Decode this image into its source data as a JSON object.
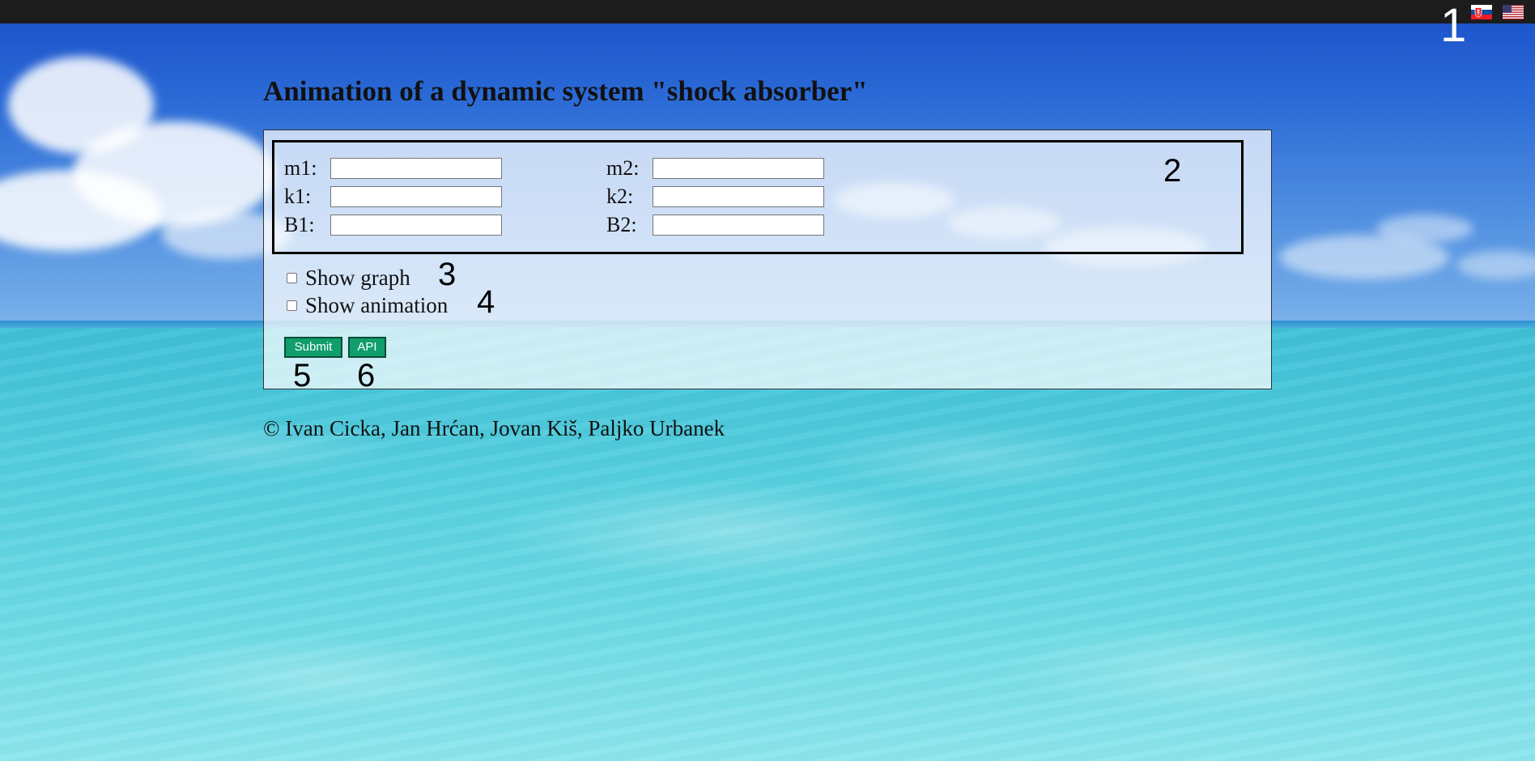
{
  "header": {
    "languages": [
      {
        "code": "sk",
        "icon": "slovak-flag-icon"
      },
      {
        "code": "en",
        "icon": "us-flag-icon"
      }
    ],
    "annotation_marker": "1"
  },
  "main": {
    "title": "Animation of a dynamic system \"shock absorber\"",
    "params": {
      "annotation_marker": "2",
      "left": [
        {
          "label": "m1:",
          "value": ""
        },
        {
          "label": "k1:",
          "value": ""
        },
        {
          "label": "B1:",
          "value": ""
        }
      ],
      "right": [
        {
          "label": "m2:",
          "value": ""
        },
        {
          "label": "k2:",
          "value": ""
        },
        {
          "label": "B2:",
          "value": ""
        }
      ]
    },
    "options": [
      {
        "label": "Show graph",
        "checked": false,
        "annotation_marker": "3"
      },
      {
        "label": "Show animation",
        "checked": false,
        "annotation_marker": "4"
      }
    ],
    "buttons": {
      "submit_label": "Submit",
      "submit_marker": "5",
      "api_label": "API",
      "api_marker": "6",
      "color": "#0f9e6c"
    }
  },
  "footer": {
    "copyright": "© Ivan Cicka, Jan Hrćan, Jovan Kiš, Paljko Urbanek"
  }
}
